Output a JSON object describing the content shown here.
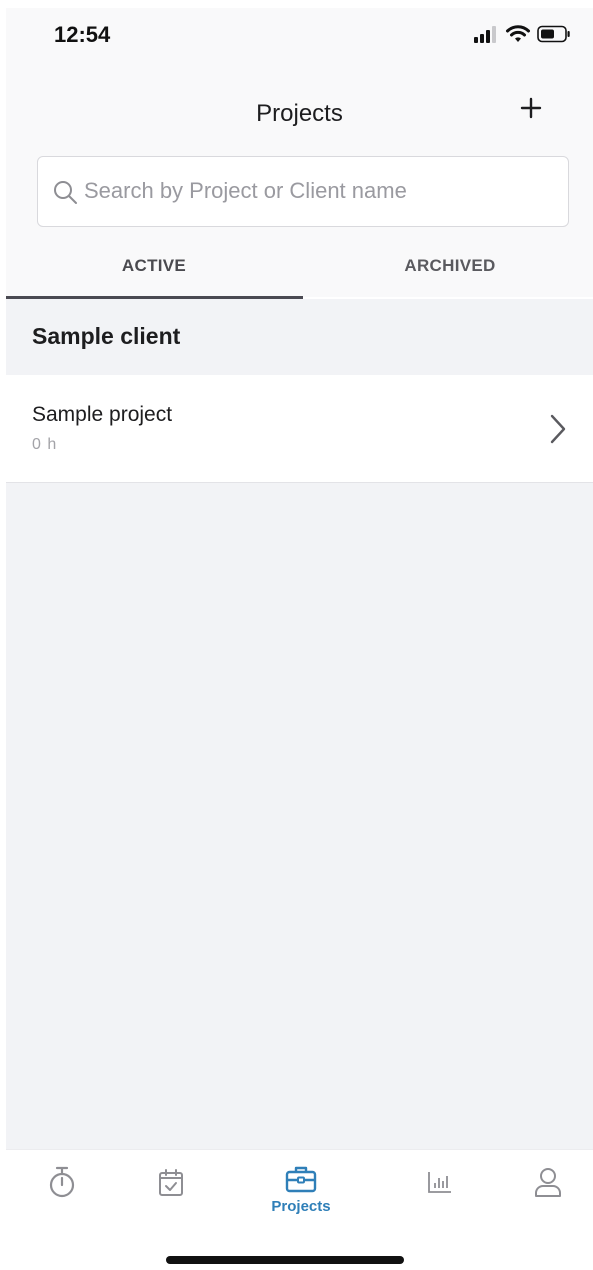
{
  "status_bar": {
    "time": "12:54",
    "icons": [
      "signal-icon",
      "wifi-icon",
      "battery-icon"
    ]
  },
  "header": {
    "title": "Projects",
    "add_icon": "plus-icon"
  },
  "search": {
    "placeholder": "Search by Project or Client name",
    "icon": "search-icon"
  },
  "tabs": [
    {
      "label": "ACTIVE",
      "selected": true
    },
    {
      "label": "ARCHIVED",
      "selected": false
    }
  ],
  "groups": [
    {
      "client": "Sample client",
      "projects": [
        {
          "name": "Sample project",
          "hours": "0 h"
        }
      ]
    }
  ],
  "tabbar": {
    "items": [
      {
        "icon": "stopwatch-icon",
        "label": ""
      },
      {
        "icon": "calendar-check-icon",
        "label": ""
      },
      {
        "icon": "briefcase-icon",
        "label": "Projects",
        "selected": true
      },
      {
        "icon": "bar-chart-icon",
        "label": ""
      },
      {
        "icon": "user-icon",
        "label": ""
      }
    ]
  },
  "colors": {
    "accent": "#2f7fb8",
    "inactive_icon": "#9a9aa0",
    "content_background": "#f2f3f6"
  }
}
